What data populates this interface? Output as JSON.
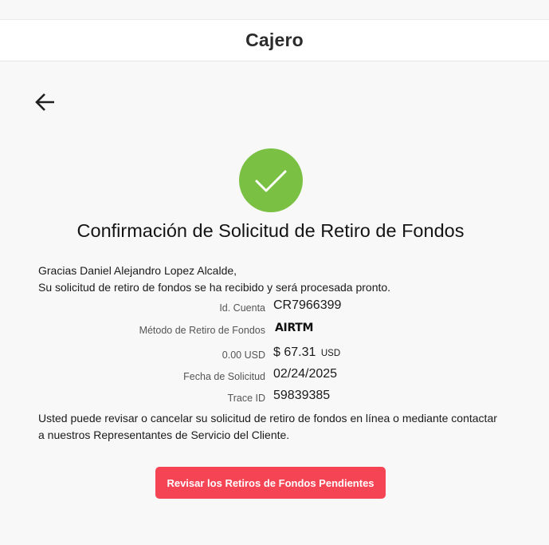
{
  "header": {
    "title": "Cajero"
  },
  "confirmation": {
    "title": "Confirmación de Solicitud de Retiro de Fondos",
    "greeting_line1": "Gracias Daniel Alejandro Lopez Alcalde,",
    "greeting_line2": "Su solicitud de retiro de fondos se ha recibido y será procesada pronto.",
    "success_color": "#7ac143"
  },
  "details": {
    "account": {
      "label": "Id. Cuenta",
      "value": "CR7966399"
    },
    "method": {
      "label": "Método de Retiro de Fondos",
      "value": "AIRTM"
    },
    "amount": {
      "label": "0.00 USD",
      "value": "$ 67.31",
      "currency": "USD"
    },
    "date": {
      "label": "Fecha de Solicitud",
      "value": "02/24/2025"
    },
    "trace": {
      "label": "Trace ID",
      "value": "59839385"
    }
  },
  "note": {
    "line1": "Usted puede revisar o cancelar su solicitud de retiro de fondos en línea o mediante contactar",
    "line2": "a nuestros Representantes de Servicio del Cliente."
  },
  "actions": {
    "review_label": "Revisar los Retiros de Fondos Pendientes",
    "review_color": "#f54555"
  },
  "icons": {
    "back": "arrow-left-icon",
    "success": "checkmark-icon"
  }
}
